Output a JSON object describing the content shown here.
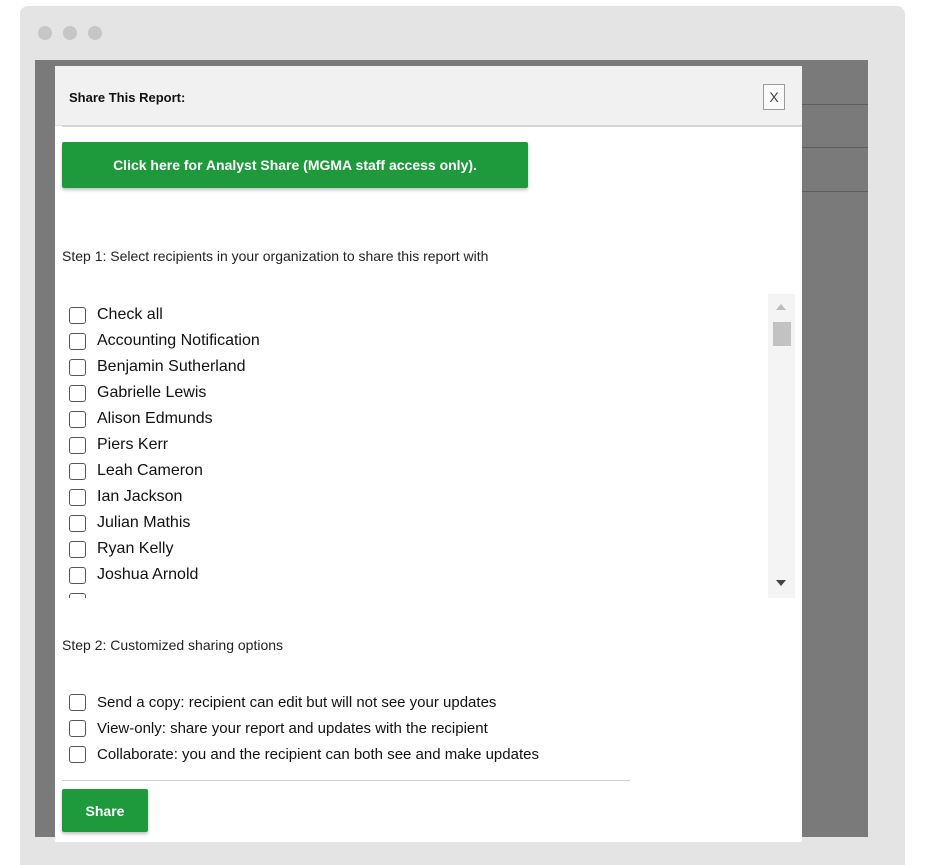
{
  "modal": {
    "title": "Share This Report:",
    "close_label": "X",
    "analyst_button_label": "Click here for Analyst Share (MGMA staff access only)."
  },
  "step1": {
    "label": "Step 1: Select recipients in your organization to share this report with",
    "items": [
      {
        "label": "Check all",
        "checked": false
      },
      {
        "label": "Accounting Notification",
        "checked": false
      },
      {
        "label": "Benjamin Sutherland",
        "checked": false
      },
      {
        "label": "Gabrielle Lewis",
        "checked": false
      },
      {
        "label": "Alison Edmunds",
        "checked": false
      },
      {
        "label": "Piers Kerr",
        "checked": false
      },
      {
        "label": "Leah Cameron",
        "checked": false
      },
      {
        "label": "Ian Jackson",
        "checked": false
      },
      {
        "label": "Julian Mathis",
        "checked": false
      },
      {
        "label": "Ryan Kelly",
        "checked": false
      },
      {
        "label": "Joshua Arnold",
        "checked": false
      }
    ]
  },
  "step2": {
    "label": "Step 2: Customized sharing options",
    "options": [
      {
        "label": "Send a copy: recipient can edit but will not see your updates",
        "checked": false
      },
      {
        "label": "View-only: share your report and updates with the recipient",
        "checked": false
      },
      {
        "label": "Collaborate: you and the recipient can both see and make updates",
        "checked": false
      }
    ]
  },
  "share_button_label": "Share",
  "colors": {
    "accent_green": "#1e9a3c",
    "window_chrome": "#e4e4e4",
    "backdrop": "#7a7a7a"
  },
  "icons": {
    "close": "close-icon",
    "scroll_up": "chevron-up-icon",
    "scroll_down": "chevron-down-icon"
  }
}
